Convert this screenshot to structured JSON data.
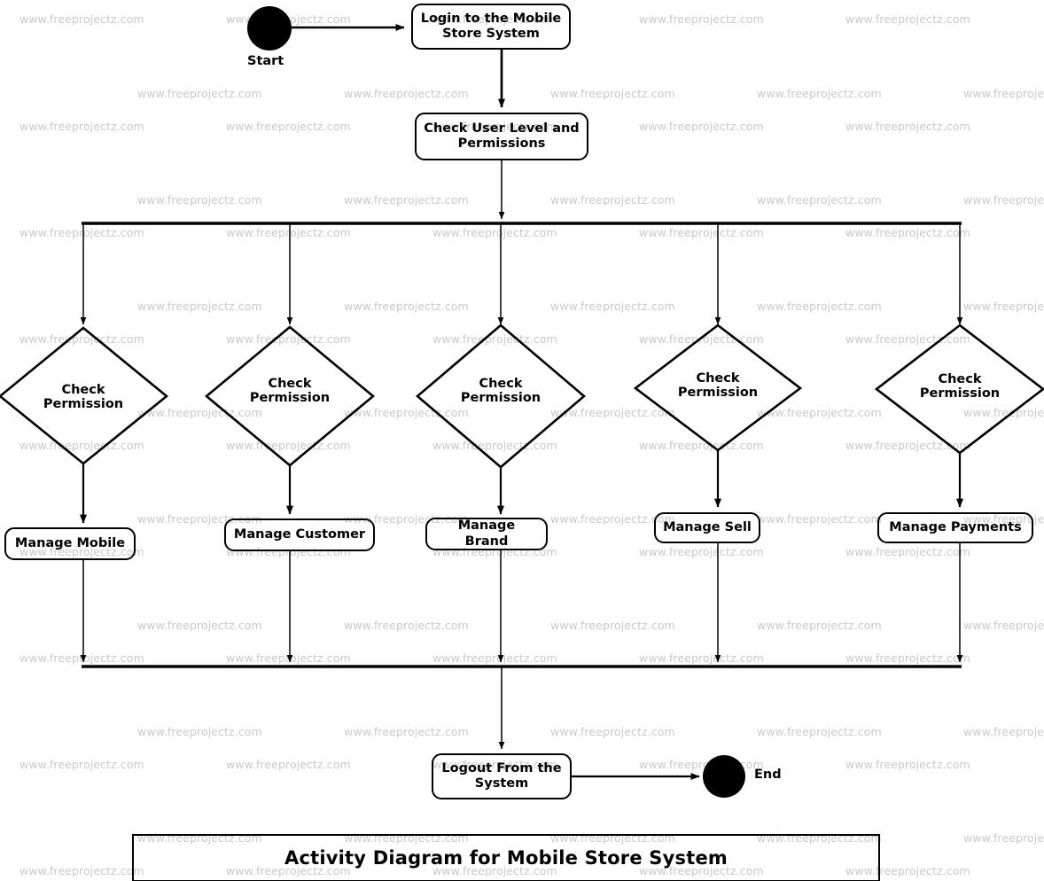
{
  "diagram": {
    "title": "Activity Diagram for Mobile Store System",
    "start_label": "Start",
    "end_label": "End",
    "login_activity": "Login to the Mobile Store System",
    "check_user_activity": "Check User Level and Permissions",
    "logout_activity": "Logout From the System",
    "decisions": [
      {
        "label": "Check\nPermission"
      },
      {
        "label": "Check\nPermission"
      },
      {
        "label": "Check\nPermission"
      },
      {
        "label": "Check\nPermission"
      },
      {
        "label": "Check\nPermission"
      }
    ],
    "decision_label_line1": "Check",
    "decision_label_line2": "Permission",
    "activities": [
      {
        "label": "Manage Mobile"
      },
      {
        "label": "Manage Customer"
      },
      {
        "label": "Manage Brand"
      },
      {
        "label": "Manage Sell"
      },
      {
        "label": "Manage Payments"
      }
    ],
    "colors": {
      "stroke": "#000000",
      "fill": "#ffffff",
      "watermark": "#c9c9c9",
      "background": "#ffffff"
    }
  },
  "watermark": {
    "text": "www.freeprojectz.com"
  }
}
